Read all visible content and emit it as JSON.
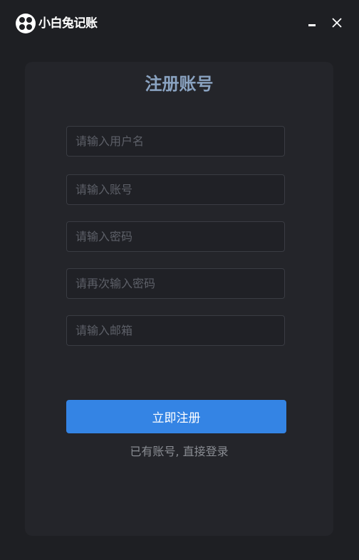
{
  "titlebar": {
    "app_name": "小白兔记账",
    "logo_icon": "app-logo-icon",
    "minimize_icon": "minimize-icon",
    "close_icon": "close-icon"
  },
  "form": {
    "title": "注册账号",
    "fields": {
      "username": {
        "placeholder": "请输入用户名",
        "value": ""
      },
      "account": {
        "placeholder": "请输入账号",
        "value": ""
      },
      "password": {
        "placeholder": "请输入密码",
        "value": ""
      },
      "confirm_password": {
        "placeholder": "请再次输入密码",
        "value": ""
      },
      "email": {
        "placeholder": "请输入邮箱",
        "value": ""
      }
    },
    "submit_label": "立即注册",
    "login_link": "已有账号, 直接登录"
  },
  "colors": {
    "background": "#1e1f23",
    "card": "#24252a",
    "accent": "#3484e4",
    "title": "#8aa3c1"
  }
}
